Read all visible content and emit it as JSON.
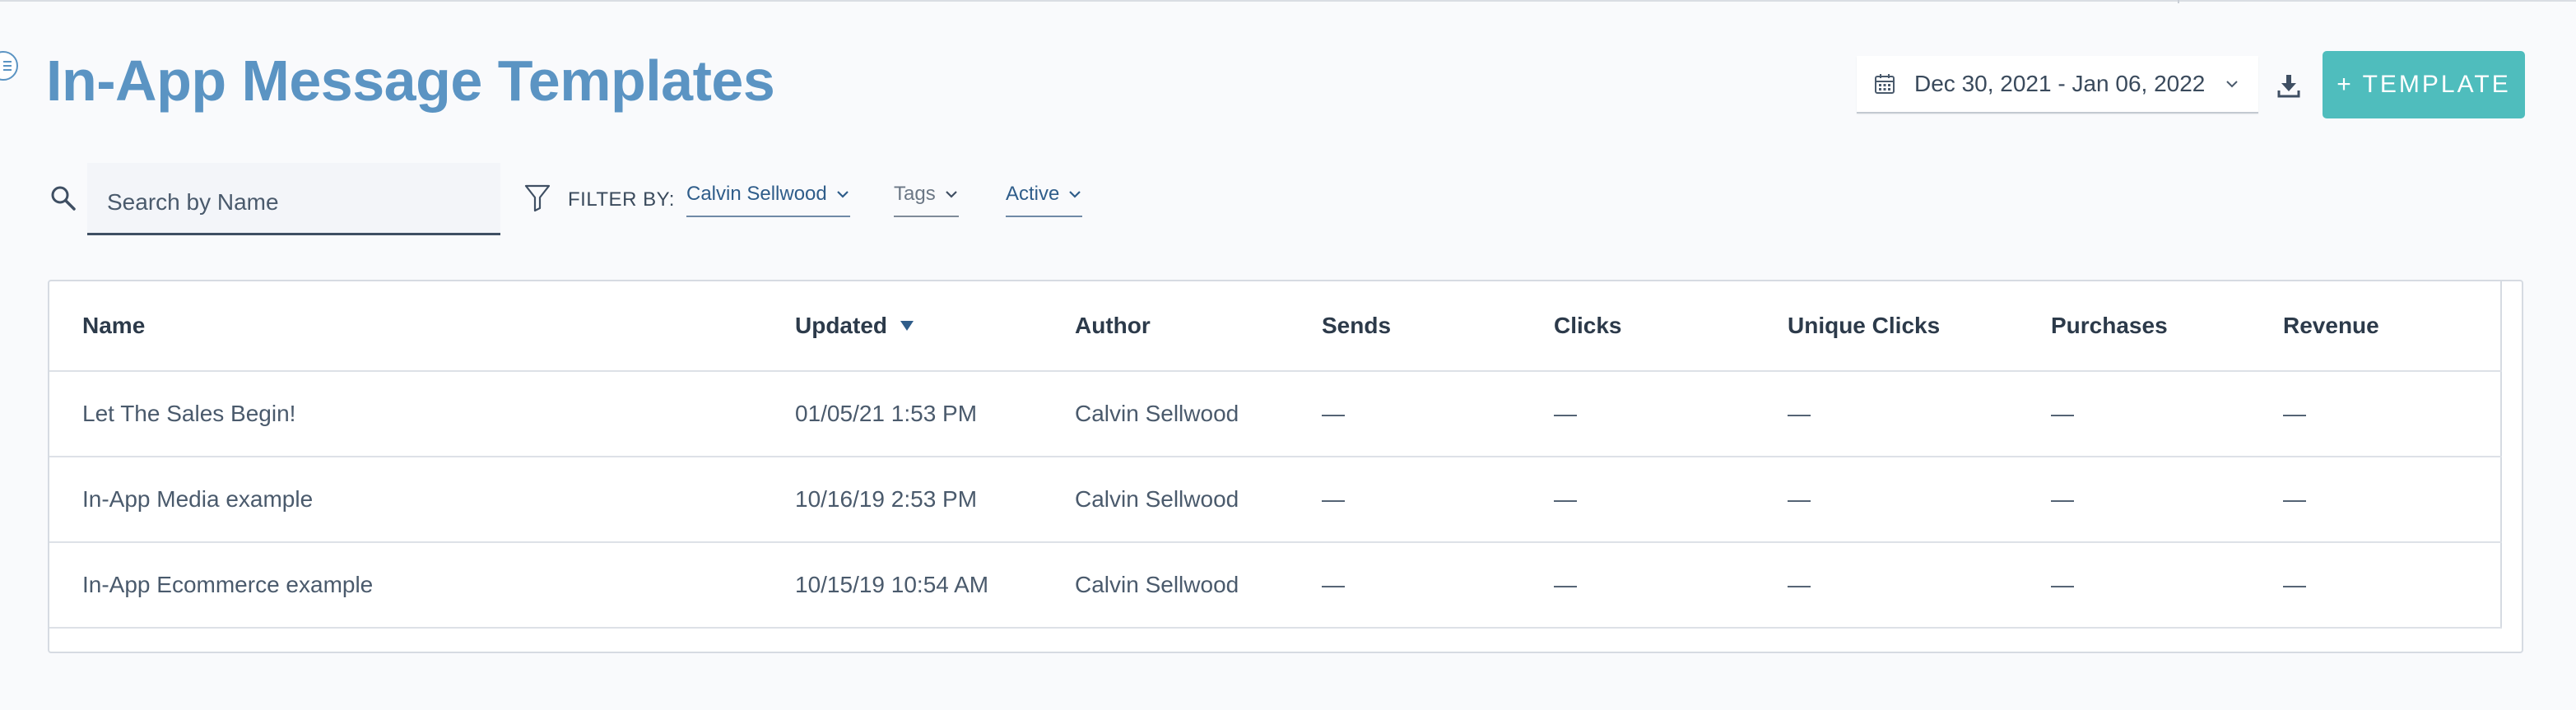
{
  "header": {
    "title": "In-App Message Templates",
    "date_range": "Dec 30, 2021 - Jan 06, 2022",
    "add_template_label": "+ TEMPLATE"
  },
  "search": {
    "placeholder": "Search by Name",
    "value": ""
  },
  "filters": {
    "label": "FILTER BY:",
    "author": "Calvin Sellwood",
    "tags": "Tags",
    "status": "Active"
  },
  "table": {
    "columns": [
      "Name",
      "Updated",
      "Author",
      "Sends",
      "Clicks",
      "Unique Clicks",
      "Purchases",
      "Revenue"
    ],
    "sort_column": "Updated",
    "sort_direction": "descending",
    "rows": [
      {
        "name": "Let The Sales Begin!",
        "updated": "01/05/21 1:53 PM",
        "author": "Calvin Sellwood",
        "sends": "—",
        "clicks": "—",
        "unique_clicks": "—",
        "purchases": "—",
        "revenue": "—"
      },
      {
        "name": "In-App Media example",
        "updated": "10/16/19 2:53 PM",
        "author": "Calvin Sellwood",
        "sends": "—",
        "clicks": "—",
        "unique_clicks": "—",
        "purchases": "—",
        "revenue": "—"
      },
      {
        "name": "In-App Ecommerce example",
        "updated": "10/15/19 10:54 AM",
        "author": "Calvin Sellwood",
        "sends": "—",
        "clicks": "—",
        "unique_clicks": "—",
        "purchases": "—",
        "revenue": "—"
      }
    ]
  },
  "colors": {
    "title": "#5b94c3",
    "primary_button": "#4fbdbd",
    "filter_link": "#2f5d8a",
    "background": "#f9fafc"
  },
  "icons": {
    "menu": "menu-toggle-icon",
    "calendar": "calendar-icon",
    "chevron": "chevron-down-icon",
    "download": "download-icon",
    "search": "search-icon",
    "filter": "filter-icon",
    "sort": "sort-desc-icon"
  }
}
